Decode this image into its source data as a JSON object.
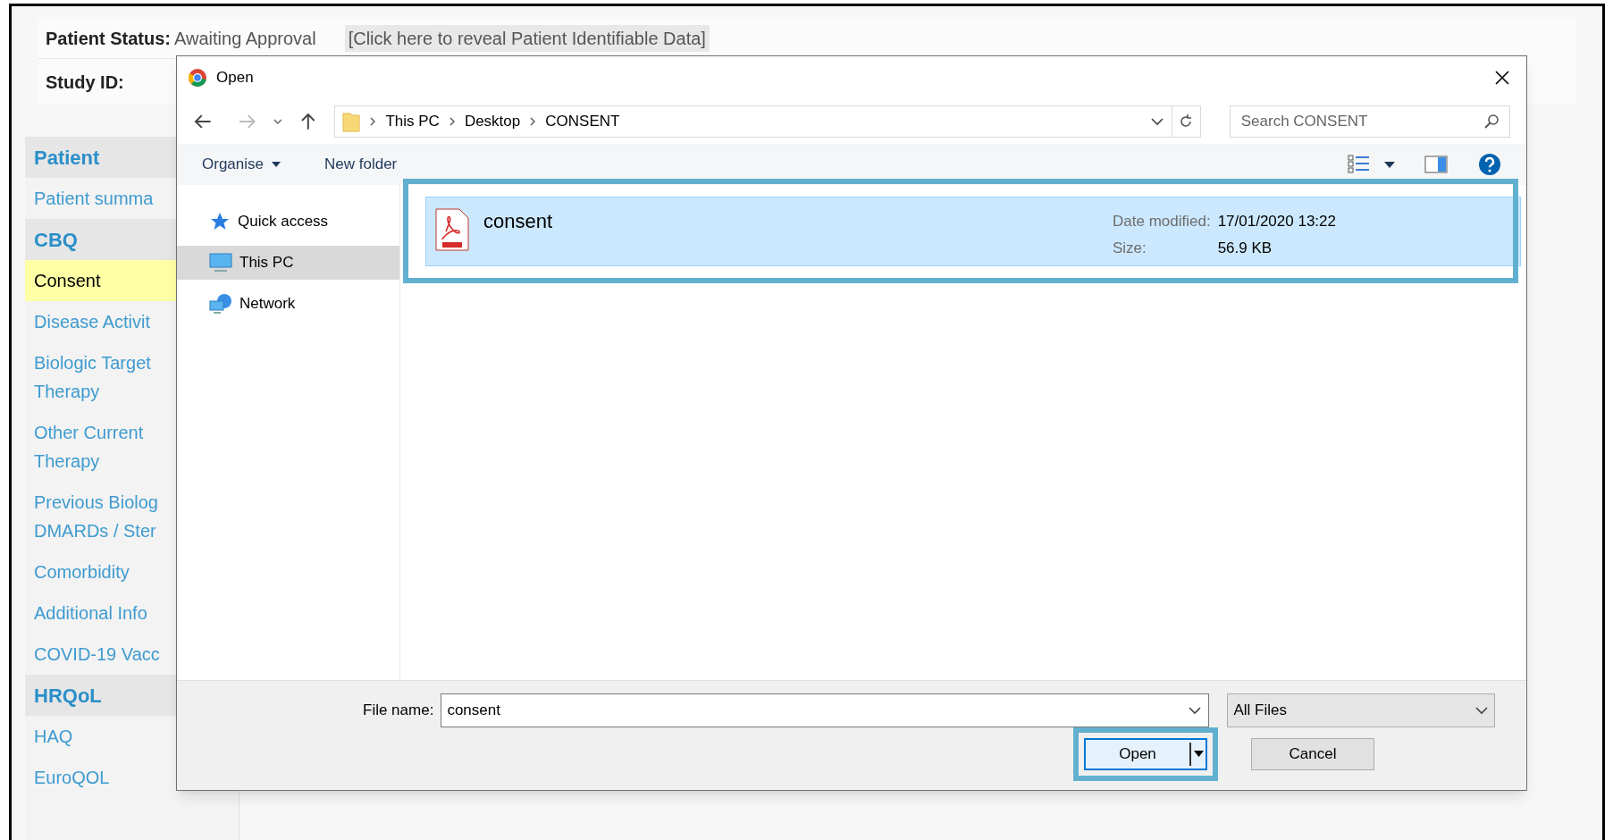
{
  "page": {
    "patient_status": {
      "label": "Patient Status:",
      "value": "Awaiting Approval",
      "reveal_link": "[Click here to reveal Patient Identifiable Data]"
    },
    "study_id": {
      "label": "Study ID:"
    }
  },
  "sidebar": [
    {
      "title": "Patient",
      "items": [
        {
          "label": "Patient summa",
          "selected": false
        }
      ]
    },
    {
      "title": "CBQ",
      "items": [
        {
          "label": "Consent",
          "selected": true
        },
        {
          "label": "Disease Activit",
          "selected": false
        },
        {
          "label": "Biologic Target\nTherapy",
          "selected": false
        },
        {
          "label": "Other Current\nTherapy",
          "selected": false
        },
        {
          "label": "Previous Biolog\nDMARDs / Ster",
          "selected": false
        },
        {
          "label": "Comorbidity",
          "selected": false
        },
        {
          "label": "Additional Info",
          "selected": false
        },
        {
          "label": "COVID-19 Vacc",
          "selected": false
        }
      ]
    },
    {
      "title": "HRQoL",
      "items": [
        {
          "label": "HAQ",
          "selected": false
        },
        {
          "label": "EuroQOL",
          "selected": false
        }
      ]
    }
  ],
  "dialog": {
    "title": "Open",
    "breadcrumbs": [
      "This PC",
      "Desktop",
      "CONSENT"
    ],
    "search": {
      "placeholder": "Search CONSENT"
    },
    "toolbar": {
      "organise": "Organise",
      "new_folder": "New folder"
    },
    "nav": [
      {
        "label": "Quick access",
        "kind": "star",
        "selected": false
      },
      {
        "label": "This PC",
        "kind": "computer",
        "selected": true
      },
      {
        "label": "Network",
        "kind": "network",
        "selected": false
      }
    ],
    "files": [
      {
        "name": "consent",
        "date_label": "Date modified:",
        "date": "17/01/2020 13:22",
        "size_label": "Size:",
        "size": "56.9 KB",
        "selected": true,
        "highlighted": true
      }
    ],
    "file_name": {
      "label": "File name:",
      "value": "consent"
    },
    "file_type": "All Files",
    "buttons": [
      {
        "label": "Open",
        "kind": "split",
        "highlighted": true
      },
      {
        "label": "Cancel",
        "kind": "plain",
        "highlighted": false
      }
    ]
  }
}
